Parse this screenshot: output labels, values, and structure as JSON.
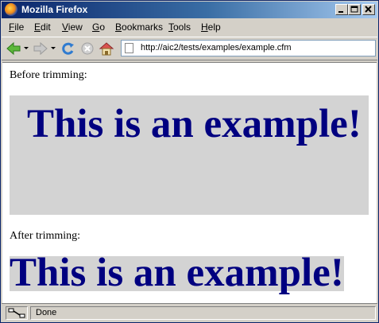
{
  "window": {
    "title": "Mozilla Firefox"
  },
  "menu": {
    "file": {
      "acc": "F",
      "rest": "ile"
    },
    "edit": {
      "acc": "E",
      "rest": "dit"
    },
    "view": {
      "acc": "V",
      "rest": "iew"
    },
    "go": {
      "acc": "G",
      "rest": "o"
    },
    "bookmarks": {
      "acc": "B",
      "rest": "ookmarks"
    },
    "tools": {
      "acc": "T",
      "rest": "ools"
    },
    "help": {
      "acc": "H",
      "rest": "elp"
    }
  },
  "toolbar": {
    "url": "http://aic2/tests/examples/example.cfm",
    "icons": [
      "back-arrow-icon",
      "forward-arrow-icon",
      "reload-icon",
      "stop-icon",
      "home-icon"
    ]
  },
  "page": {
    "before_label": "Before trimming:",
    "before_text": "This is an example!",
    "after_label": "After trimming:",
    "after_text": "This is an example!",
    "colors": {
      "text": "#000080",
      "box": "#d3d3d3"
    }
  },
  "status": {
    "text": "Done"
  }
}
